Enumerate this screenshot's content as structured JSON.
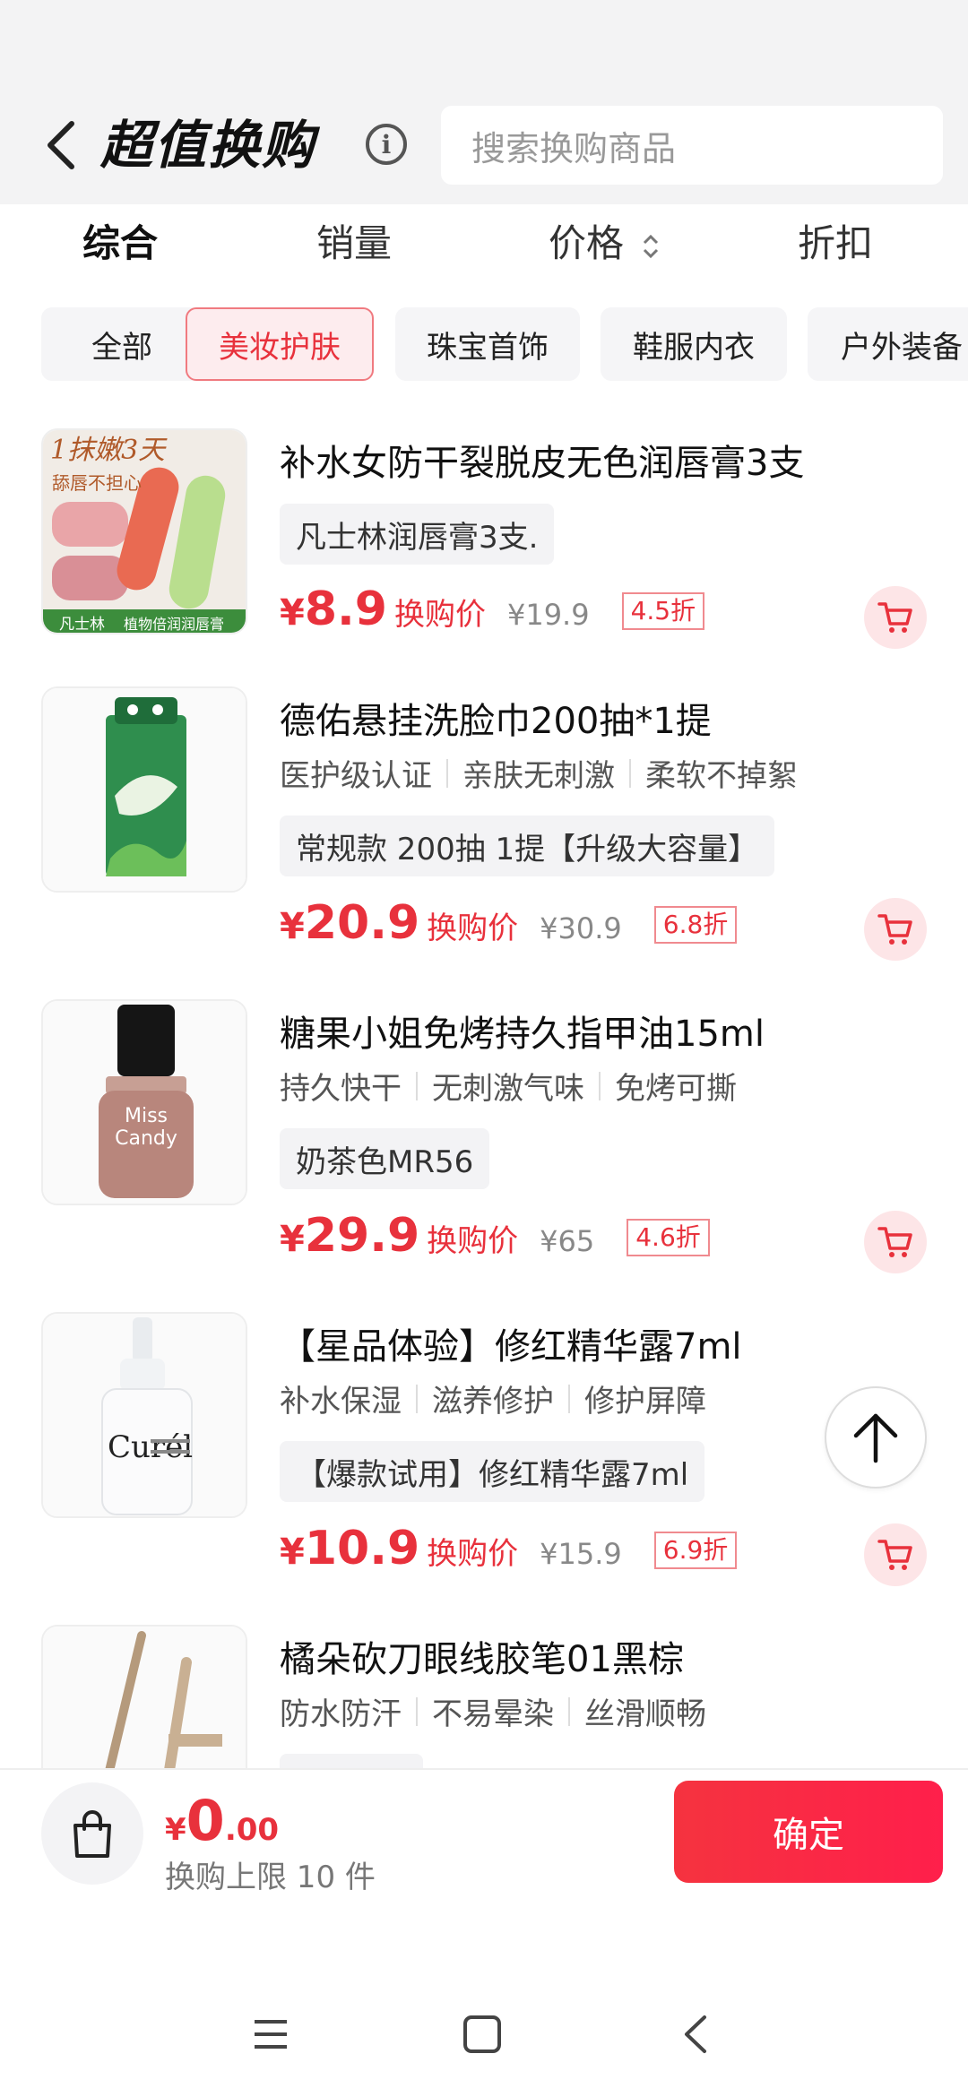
{
  "header": {
    "title": "超值换购",
    "search_placeholder": "搜索换购商品"
  },
  "sort": {
    "items": [
      "综合",
      "销量",
      "价格",
      "折扣"
    ],
    "active": "综合"
  },
  "categories": {
    "items": [
      "全部",
      "美妆护肤",
      "珠宝首饰",
      "鞋服内衣",
      "户外装备"
    ],
    "active": "美妆护肤"
  },
  "products": [
    {
      "title": "补水女防干裂脱皮无色润唇膏3支",
      "tags": [],
      "spec": "凡士林润唇膏3支.",
      "currency": "¥",
      "price": "8.9",
      "price_label": "换购价",
      "original_price": "¥19.9",
      "discount": "4.5折",
      "image_text": {
        "line1": "1抹嫩3天",
        "line2": "舔唇不担心",
        "brand": "凡士林",
        "sub": "植物倍润润唇膏"
      }
    },
    {
      "title": "德佑悬挂洗脸巾200抽*1提",
      "tags": [
        "医护级认证",
        "亲肤无刺激",
        "柔软不掉絮"
      ],
      "spec": "常规款 200抽 1提【升级大容量】",
      "currency": "¥",
      "price": "20.9",
      "price_label": "换购价",
      "original_price": "¥30.9",
      "discount": "6.8折"
    },
    {
      "title": "糖果小姐免烤持久指甲油15ml",
      "tags": [
        "持久快干",
        "无刺激气味",
        "免烤可撕"
      ],
      "spec": "奶茶色MR56",
      "currency": "¥",
      "price": "29.9",
      "price_label": "换购价",
      "original_price": "¥65",
      "discount": "4.6折",
      "image_text": {
        "brand1": "Miss",
        "brand2": "Candy"
      }
    },
    {
      "title": "【星品体验】修红精华露7ml",
      "tags": [
        "补水保湿",
        "滋养修护",
        "修护屏障"
      ],
      "spec": "【爆款试用】修红精华露7ml",
      "currency": "¥",
      "price": "10.9",
      "price_label": "换购价",
      "original_price": "¥15.9",
      "discount": "6.9折",
      "image_text": {
        "brand": "Curél"
      }
    },
    {
      "title": "橘朵砍刀眼线胶笔01黑棕",
      "tags": [
        "防水防汗",
        "不易晕染",
        "丝滑顺畅"
      ]
    }
  ],
  "bottom": {
    "currency": "¥",
    "total_int": "0",
    "total_dec": ".00",
    "limit_text": "换购上限 10 件",
    "confirm_label": "确定"
  },
  "colors": {
    "accent": "#e8313c",
    "header_bg": "#f3f3f4",
    "chip_active_bg": "#fdecee"
  },
  "icons": [
    "back-arrow-icon",
    "info-icon",
    "sort-arrows-icon",
    "cart-icon",
    "arrow-up-icon",
    "shopping-bag-icon",
    "menu-icon",
    "home-square-icon",
    "nav-back-icon"
  ]
}
